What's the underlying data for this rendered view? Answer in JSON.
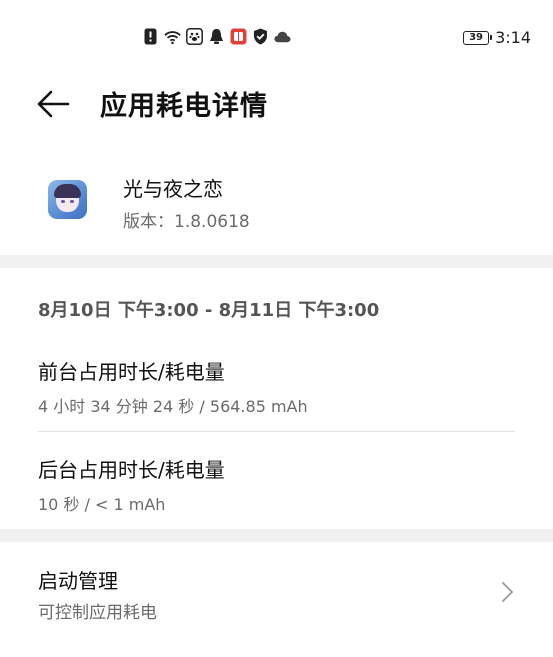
{
  "status_bar": {
    "time": "3:14",
    "battery_level": "39",
    "icons": [
      "alert-icon",
      "wifi-icon",
      "paw-app-icon",
      "qq-bell-icon",
      "red-app-icon",
      "shield-icon",
      "cloud-icon"
    ]
  },
  "header": {
    "title": "应用耗电详情"
  },
  "app": {
    "name": "光与夜之恋",
    "version": "版本：1.8.0618"
  },
  "date_range": "8月10日 下午3:00 - 8月11日 下午3:00",
  "foreground": {
    "title": "前台占用时长/耗电量",
    "value": "4 小时 34 分钟 24 秒 / 564.85 mAh"
  },
  "background": {
    "title": "后台占用时长/耗电量",
    "value": "10 秒 / < 1 mAh"
  },
  "launch": {
    "title": "启动管理",
    "subtitle": "可控制应用耗电"
  },
  "colors": {
    "band": "#f1f1f1",
    "secondary_text": "#6b6b6b",
    "primary_text": "#111111"
  }
}
